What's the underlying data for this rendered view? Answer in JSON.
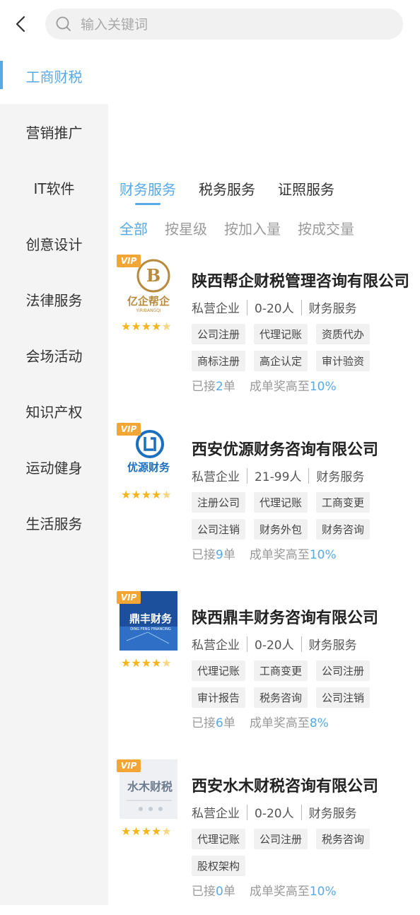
{
  "search": {
    "placeholder": "输入关键词"
  },
  "sidebar": {
    "items": [
      {
        "label": "工商财税"
      },
      {
        "label": "营销推广"
      },
      {
        "label": "IT软件"
      },
      {
        "label": "创意设计"
      },
      {
        "label": "法律服务"
      },
      {
        "label": "会场活动"
      },
      {
        "label": "知识产权"
      },
      {
        "label": "运动健身"
      },
      {
        "label": "生活服务"
      }
    ]
  },
  "tabs": [
    {
      "label": "财务服务"
    },
    {
      "label": "税务服务"
    },
    {
      "label": "证照服务"
    }
  ],
  "sort": [
    {
      "label": "全部"
    },
    {
      "label": "按星级"
    },
    {
      "label": "按加入量"
    },
    {
      "label": "按成交量"
    }
  ],
  "vip_label": "VIP",
  "companies": [
    {
      "name": "陕西帮企财税管理咨询有限公司",
      "type": "私营企业",
      "size": "0-20人",
      "category": "财务服务",
      "tags": [
        "公司注册",
        "代理记账",
        "资质代办",
        "商标注册",
        "高企认定",
        "审计验资"
      ],
      "orders_prefix": "已接",
      "orders": "2",
      "orders_suffix": "单",
      "reward_prefix": "成单奖高至",
      "reward": "10%",
      "rating": 4.5,
      "logo_text": "亿企帮企",
      "logo_sub": "YIRIBANGQI"
    },
    {
      "name": "西安优源财务咨询有限公司",
      "type": "私营企业",
      "size": "21-99人",
      "category": "财务服务",
      "tags": [
        "注册公司",
        "代理记账",
        "工商变更",
        "公司注销",
        "财务外包",
        "财务咨询"
      ],
      "orders_prefix": "已接",
      "orders": "9",
      "orders_suffix": "单",
      "reward_prefix": "成单奖高至",
      "reward": "10%",
      "rating": 4.5,
      "logo_text": "优源财务"
    },
    {
      "name": "陕西鼎丰财务咨询有限公司",
      "type": "私营企业",
      "size": "0-20人",
      "category": "财务服务",
      "tags": [
        "代理记账",
        "工商变更",
        "公司注册",
        "审计报告",
        "税务咨询",
        "公司注销"
      ],
      "orders_prefix": "已接",
      "orders": "6",
      "orders_suffix": "单",
      "reward_prefix": "成单奖高至",
      "reward": "8%",
      "rating": 4.5,
      "logo_text": "鼎丰财务",
      "logo_sub": "DING FENG FINANCING"
    },
    {
      "name": "西安水木财税咨询有限公司",
      "type": "私营企业",
      "size": "0-20人",
      "category": "财务服务",
      "tags": [
        "代理记账",
        "公司注册",
        "税务咨询",
        "股权架构"
      ],
      "orders_prefix": "已接",
      "orders": "0",
      "orders_suffix": "单",
      "reward_prefix": "成单奖高至",
      "reward": "10%",
      "rating": 4.5,
      "logo_text": "水木财税"
    }
  ],
  "colors": {
    "accent": "#57a9e6",
    "vip": "#f3a633",
    "star": "#f5b61c"
  }
}
